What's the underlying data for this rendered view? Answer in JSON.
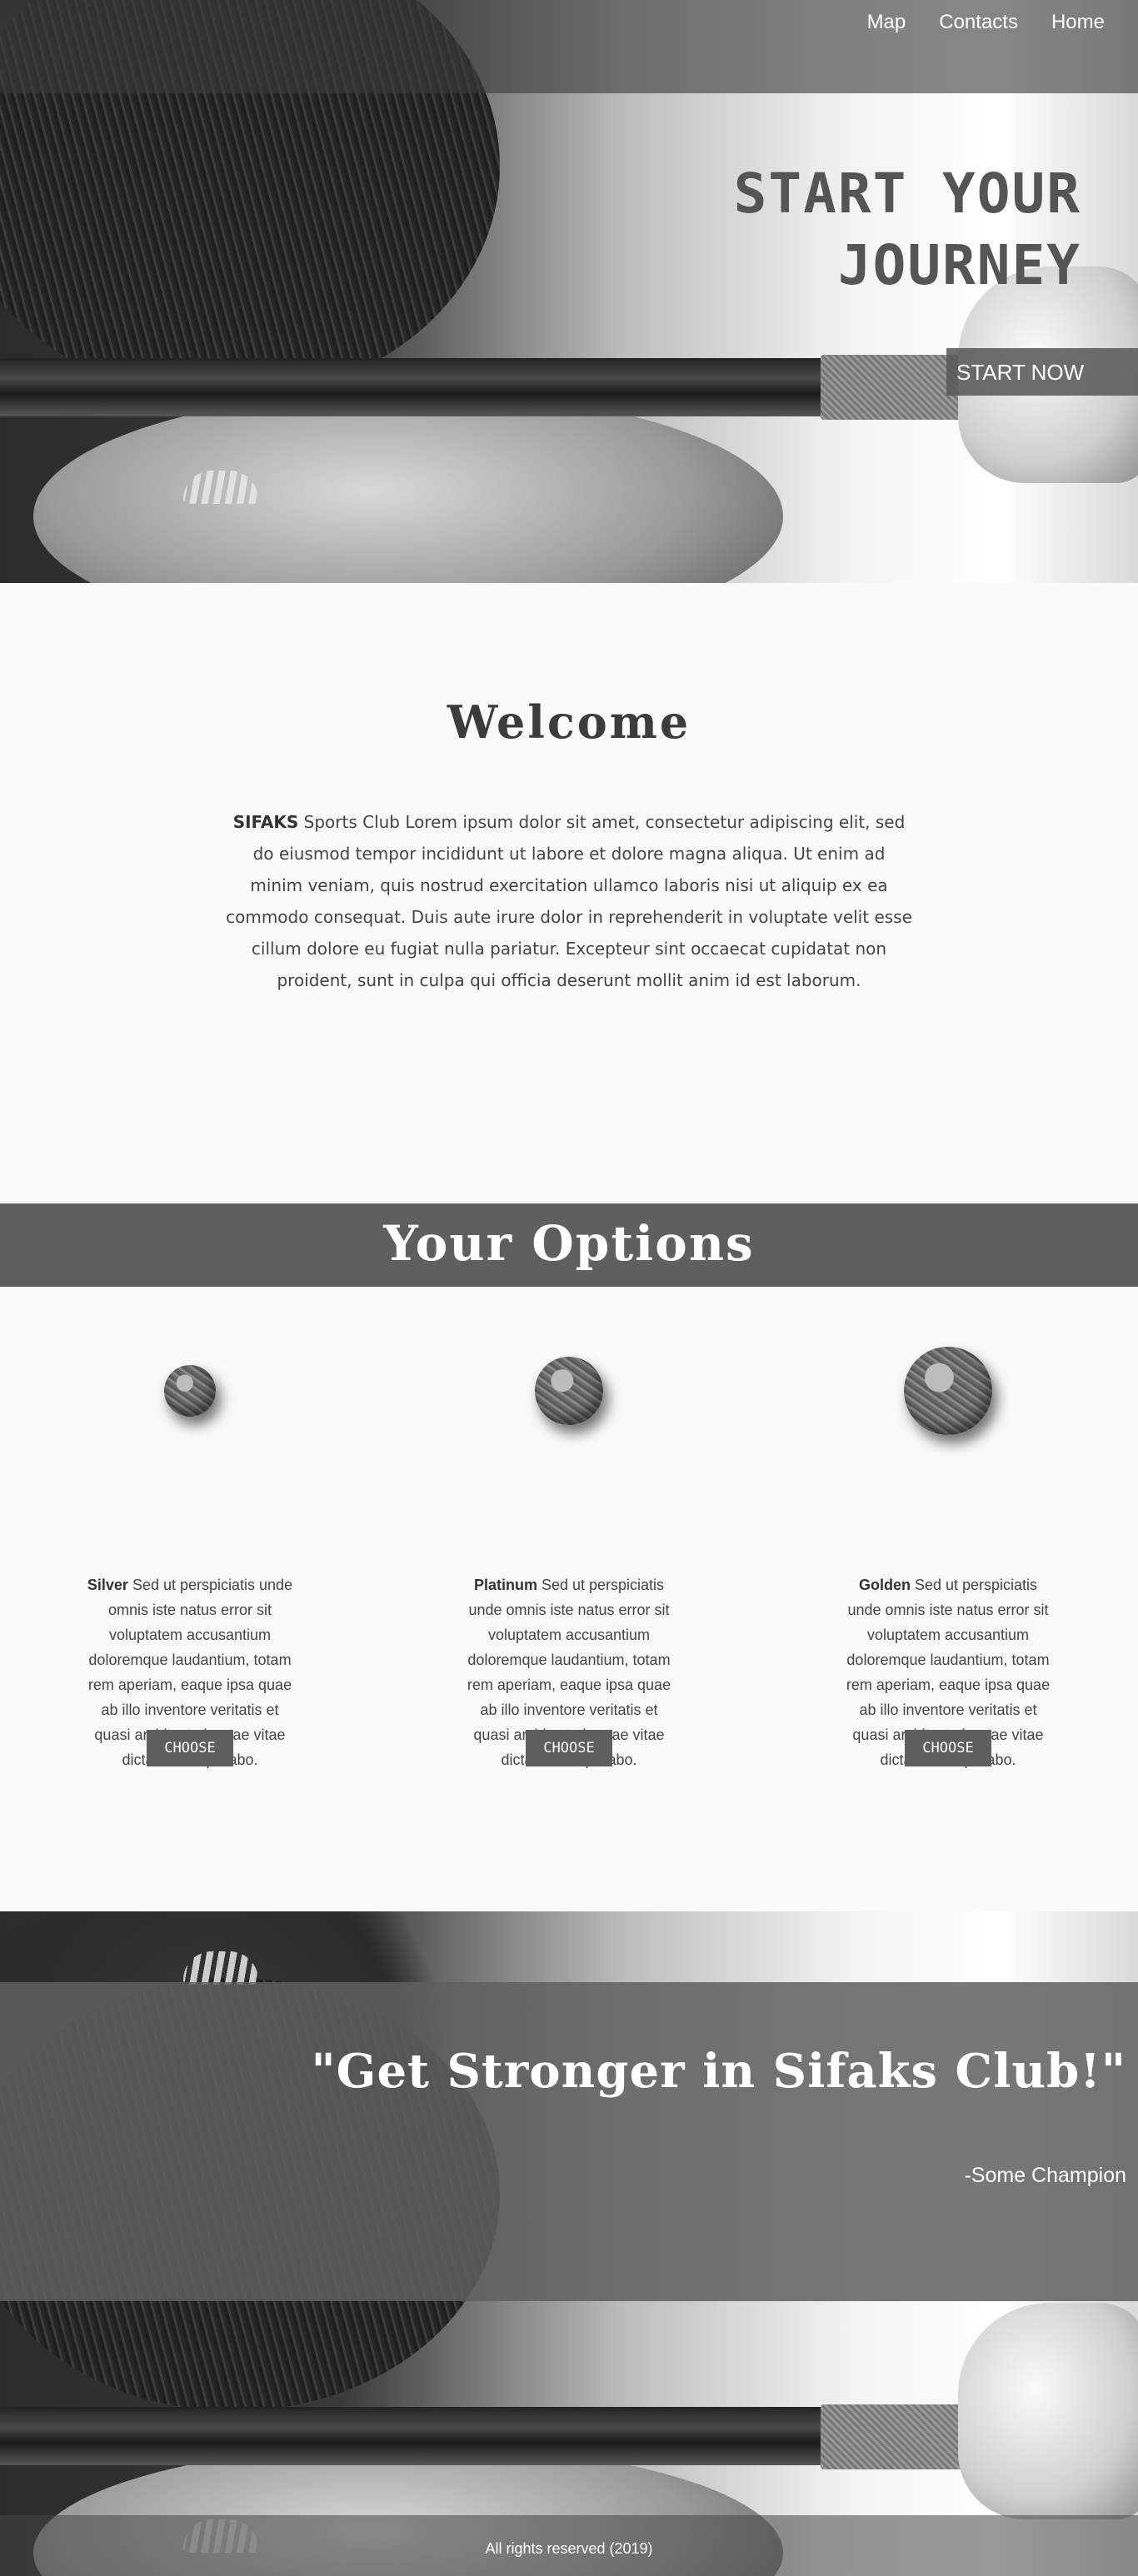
{
  "nav": {
    "items": [
      {
        "label": "Map"
      },
      {
        "label": "Contacts"
      },
      {
        "label": "Home"
      }
    ]
  },
  "hero": {
    "title_line1": "START YOUR",
    "title_line2": "JOURNEY",
    "cta_label": "START NOW"
  },
  "welcome": {
    "title": "Welcome",
    "brand": "SIFAKS",
    "body": " Sports Club Lorem ipsum dolor sit amet, consectetur adipiscing elit, sed do eiusmod tempor incididunt ut labore et dolore magna aliqua. Ut enim ad minim veniam, quis nostrud exercitation ullamco laboris nisi ut aliquip ex ea commodo consequat. Duis aute irure dolor in reprehenderit in voluptate velit esse cillum dolore eu fugiat nulla pariatur. Excepteur sint occaecat cupidatat non proident, sunt in culpa qui officia deserunt mollit anim id est laborum."
  },
  "options": {
    "title": "Your Options",
    "plans": [
      {
        "name": "Silver",
        "description": " Sed ut perspiciatis unde omnis iste natus error sit voluptatem accusantium doloremque laudantium, totam rem aperiam, eaque ipsa quae ab illo inventore veritatis et quasi architecto beatae vitae dicta sunt explicabo.",
        "button_label": "CHOOSE",
        "icon": "medal-icon"
      },
      {
        "name": "Platinum",
        "description": " Sed ut perspiciatis unde omnis iste natus error sit voluptatem accusantium doloremque laudantium, totam rem aperiam, eaque ipsa quae ab illo inventore veritatis et quasi architecto beatae vitae dicta sunt explicabo.",
        "button_label": "CHOOSE",
        "icon": "medal-icon"
      },
      {
        "name": "Golden",
        "description": " Sed ut perspiciatis unde omnis iste natus error sit voluptatem accusantium doloremque laudantium, totam rem aperiam, eaque ipsa quae ab illo inventore veritatis et quasi architecto beatae vitae dicta sunt explicabo.",
        "button_label": "CHOOSE",
        "icon": "medal-icon"
      }
    ]
  },
  "quote": {
    "text": "\"Get Stronger in Sifaks Club!\"",
    "author": "-Some Champion"
  },
  "footer": {
    "text": "All rights reserved (2019)"
  },
  "colors": {
    "band": "#5f5f5f",
    "page_background": "#fafafa",
    "hero_title": "#555555",
    "accent_text": "#ffffff"
  }
}
